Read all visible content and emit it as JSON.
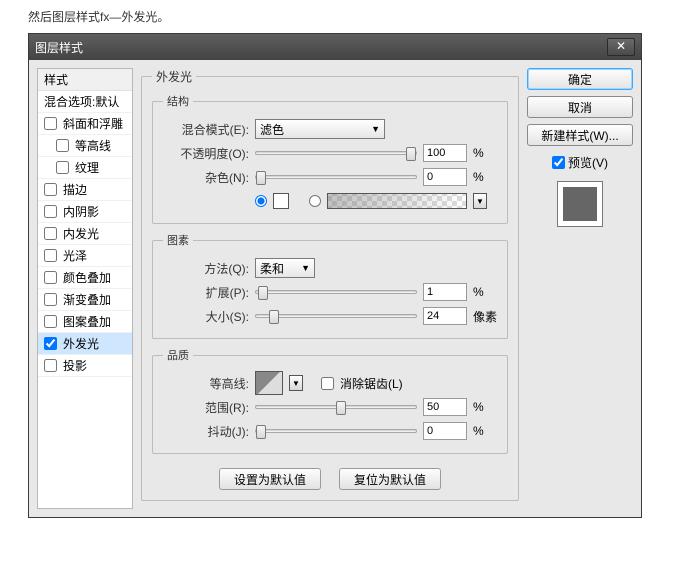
{
  "caption": "然后图层样式fx—外发光。",
  "window": {
    "title": "图层样式",
    "close": "✕"
  },
  "sidebar": {
    "styles_header": "样式",
    "blend_defaults": "混合选项:默认",
    "items": [
      {
        "label": "斜面和浮雕",
        "checked": false
      },
      {
        "label": "等高线",
        "checked": false,
        "indent": true
      },
      {
        "label": "纹理",
        "checked": false,
        "indent": true
      },
      {
        "label": "描边",
        "checked": false
      },
      {
        "label": "内阴影",
        "checked": false
      },
      {
        "label": "内发光",
        "checked": false
      },
      {
        "label": "光泽",
        "checked": false
      },
      {
        "label": "颜色叠加",
        "checked": false
      },
      {
        "label": "渐变叠加",
        "checked": false
      },
      {
        "label": "图案叠加",
        "checked": false
      },
      {
        "label": "外发光",
        "checked": true,
        "active": true
      },
      {
        "label": "投影",
        "checked": false
      }
    ]
  },
  "panel": {
    "title": "外发光",
    "structure": {
      "legend": "结构",
      "blend_label": "混合模式(E):",
      "blend_value": "滤色",
      "opacity_label": "不透明度(O):",
      "opacity_value": "100",
      "opacity_unit": "%",
      "noise_label": "杂色(N):",
      "noise_value": "0",
      "noise_unit": "%"
    },
    "elements": {
      "legend": "图素",
      "technique_label": "方法(Q):",
      "technique_value": "柔和",
      "spread_label": "扩展(P):",
      "spread_value": "1",
      "spread_unit": "%",
      "size_label": "大小(S):",
      "size_value": "24",
      "size_unit": "像素"
    },
    "quality": {
      "legend": "品质",
      "contour_label": "等高线:",
      "antialias_label": "消除锯齿(L)",
      "range_label": "范围(R):",
      "range_value": "50",
      "range_unit": "%",
      "jitter_label": "抖动(J):",
      "jitter_value": "0",
      "jitter_unit": "%"
    },
    "buttons": {
      "make_default": "设置为默认值",
      "reset_default": "复位为默认值"
    }
  },
  "right": {
    "ok": "确定",
    "cancel": "取消",
    "new_style": "新建样式(W)...",
    "preview_label": "预览(V)"
  }
}
